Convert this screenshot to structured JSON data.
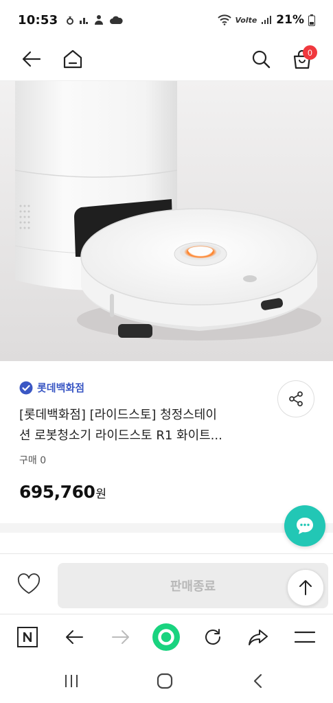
{
  "status_bar": {
    "time": "10:53",
    "network": "Volte",
    "battery": "21%"
  },
  "top_nav": {
    "cart_count": "0"
  },
  "product": {
    "seller": "롯데백화점",
    "title_line1": "[롯데백화점] [라이드스토] 청정스테이",
    "title_line2": "션 로봇청소기 라이드스토 R1 화이트...",
    "purchase_count": "구매 0",
    "price": "695,760",
    "price_unit": "원"
  },
  "action_bar": {
    "sold_out_label": "판매종료"
  },
  "icons": {
    "back": "back-arrow-icon",
    "home": "home-icon",
    "search": "search-icon",
    "cart": "shopping-bag-icon",
    "share": "share-icon",
    "chat": "chat-icon",
    "wish": "heart-icon",
    "top": "arrow-up-icon"
  },
  "colors": {
    "seller_accent": "#3a57c4",
    "badge": "#f0383e",
    "chat_fab": "#22c7b5",
    "browser_home": "#19d37f"
  }
}
